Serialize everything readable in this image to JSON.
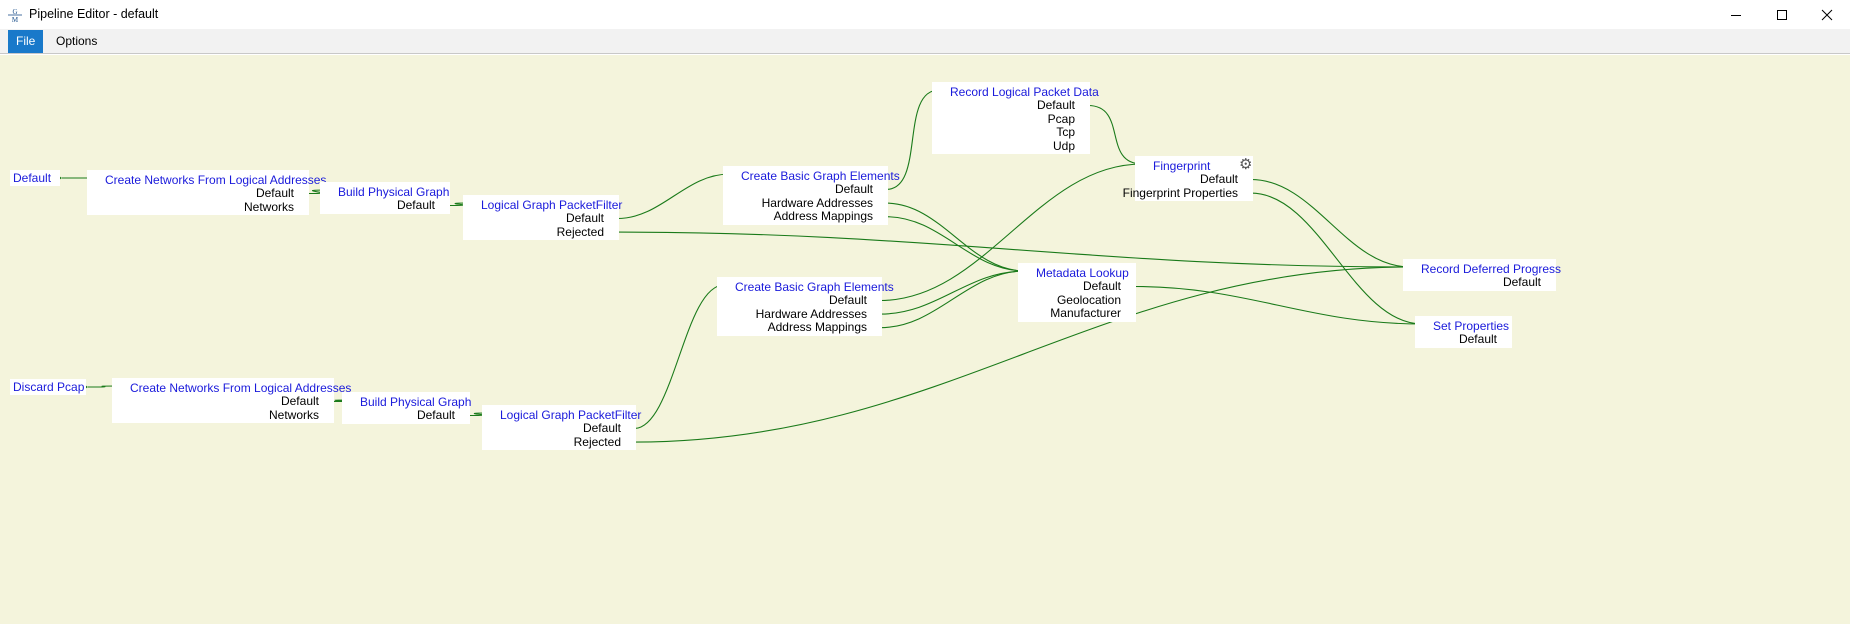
{
  "window": {
    "title": "Pipeline Editor - default",
    "icon": "gm-app-icon",
    "controls": {
      "minimize": "minimize-icon",
      "maximize": "maximize-icon",
      "close": "close-icon"
    }
  },
  "menu": {
    "items": [
      {
        "label": "File",
        "active": true
      },
      {
        "label": "Options",
        "active": false
      }
    ]
  },
  "colors": {
    "canvas_background": "#f4f4dc",
    "node_background": "#ffffff",
    "node_title": "#1a1adb",
    "port_and_wire": "#1a7a1a",
    "menu_active": "#1979ca"
  },
  "pipeline": {
    "sources": [
      {
        "id": "src_default",
        "label": "Default"
      },
      {
        "id": "src_discard",
        "label": "Discard Pcap"
      }
    ],
    "nodes": [
      {
        "id": "cn1",
        "title": "Create Networks From Logical Addresses",
        "outputs": [
          "Default",
          "Networks"
        ]
      },
      {
        "id": "bp1",
        "title": "Build Physical Graph",
        "outputs": [
          "Default"
        ]
      },
      {
        "id": "lg1",
        "title": "Logical Graph PacketFilter",
        "outputs": [
          "Default",
          "Rejected"
        ]
      },
      {
        "id": "cb1",
        "title": "Create Basic Graph Elements",
        "outputs": [
          "Default",
          "Hardware Addresses",
          "Address Mappings"
        ]
      },
      {
        "id": "rl",
        "title": "Record Logical Packet Data",
        "outputs": [
          "Default",
          "Pcap",
          "Tcp",
          "Udp"
        ]
      },
      {
        "id": "fp",
        "title": "Fingerprint",
        "outputs": [
          "Default",
          "Fingerprint Properties"
        ],
        "icon": "gear-icon"
      },
      {
        "id": "cn2",
        "title": "Create Networks From Logical Addresses",
        "outputs": [
          "Default",
          "Networks"
        ]
      },
      {
        "id": "bp2",
        "title": "Build Physical Graph",
        "outputs": [
          "Default"
        ]
      },
      {
        "id": "lg2",
        "title": "Logical Graph PacketFilter",
        "outputs": [
          "Default",
          "Rejected"
        ]
      },
      {
        "id": "cb2",
        "title": "Create Basic Graph Elements",
        "outputs": [
          "Default",
          "Hardware Addresses",
          "Address Mappings"
        ]
      },
      {
        "id": "ml",
        "title": "Metadata Lookup",
        "outputs": [
          "Default",
          "Geolocation",
          "Manufacturer"
        ]
      },
      {
        "id": "rd",
        "title": "Record Deferred Progress",
        "outputs": [
          "Default"
        ]
      },
      {
        "id": "sp",
        "title": "Set Properties",
        "outputs": [
          "Default"
        ]
      }
    ],
    "connections": [
      {
        "from": "src_default",
        "to": "cn1"
      },
      {
        "from": "cn1.Default",
        "to": "bp1"
      },
      {
        "from": "bp1.Default",
        "to": "lg1"
      },
      {
        "from": "lg1.Default",
        "to": "cb1"
      },
      {
        "from": "lg1.Rejected",
        "to": "rd"
      },
      {
        "from": "cb1.Default",
        "to": "rl"
      },
      {
        "from": "cb1.Hardware Addresses",
        "to": "ml"
      },
      {
        "from": "cb1.Address Mappings",
        "to": "ml"
      },
      {
        "from": "rl.Default",
        "to": "fp"
      },
      {
        "from": "fp.Default",
        "to": "rd"
      },
      {
        "from": "fp.Fingerprint Properties",
        "to": "sp"
      },
      {
        "from": "src_discard",
        "to": "cn2"
      },
      {
        "from": "cn2.Default",
        "to": "bp2"
      },
      {
        "from": "bp2.Default",
        "to": "lg2"
      },
      {
        "from": "lg2.Default",
        "to": "cb2"
      },
      {
        "from": "lg2.Rejected",
        "to": "rd"
      },
      {
        "from": "cb2.Default",
        "to": "fp"
      },
      {
        "from": "cb2.Hardware Addresses",
        "to": "ml"
      },
      {
        "from": "cb2.Address Mappings",
        "to": "ml"
      },
      {
        "from": "ml.Default",
        "to": "sp"
      }
    ]
  }
}
